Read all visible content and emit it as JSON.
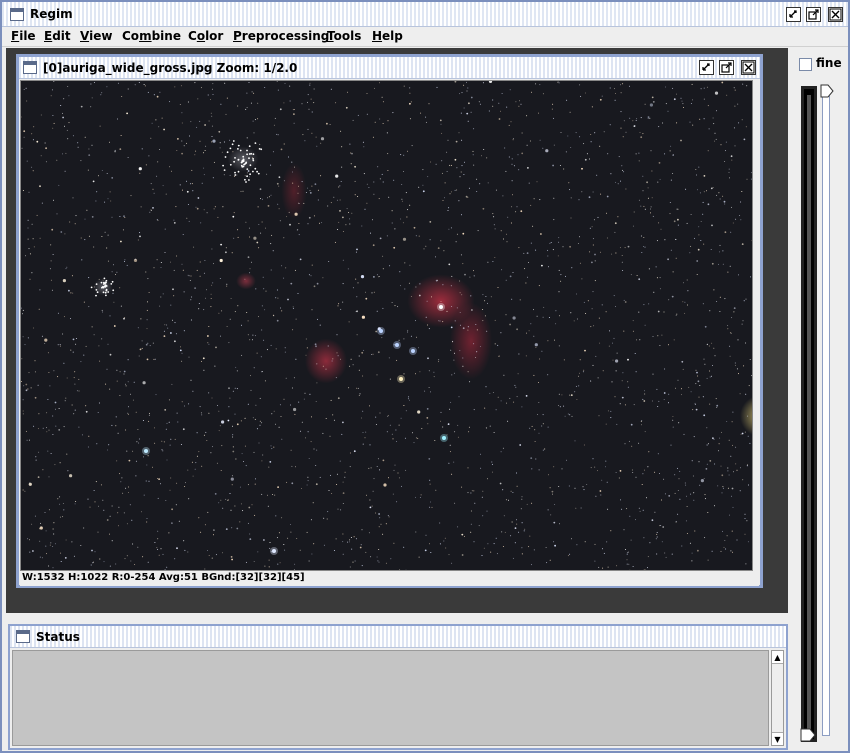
{
  "window": {
    "title": "Regim"
  },
  "menu": [
    {
      "pre": "",
      "u": "F",
      "post": "ile"
    },
    {
      "pre": "",
      "u": "E",
      "post": "dit"
    },
    {
      "pre": "",
      "u": "V",
      "post": "iew"
    },
    {
      "pre": "Co",
      "u": "m",
      "post": "bine"
    },
    {
      "pre": "C",
      "u": "o",
      "post": "lor"
    },
    {
      "pre": "",
      "u": "P",
      "post": "reprocessing"
    },
    {
      "pre": "",
      "u": "T",
      "post": "ools"
    },
    {
      "pre": "",
      "u": "H",
      "post": "elp"
    }
  ],
  "image_window": {
    "title": "[0]auriga_wide_gross.jpg  Zoom: 1/2.0",
    "status": "W:1532 H:1022 R:0-254 Avg:51 BGnd:[32][32][45]"
  },
  "right_panel": {
    "fine_label": "fine",
    "fine_checked": false
  },
  "status_window": {
    "title": "Status"
  },
  "icons": {
    "window": "window-icon",
    "minimize": "minimize-icon",
    "maximize": "maximize-icon",
    "close": "close-icon"
  },
  "colors": {
    "frame_border": "#8ea2cf",
    "desktop_bg": "#3a3a3a",
    "status_bg": "#c4c4c4"
  }
}
